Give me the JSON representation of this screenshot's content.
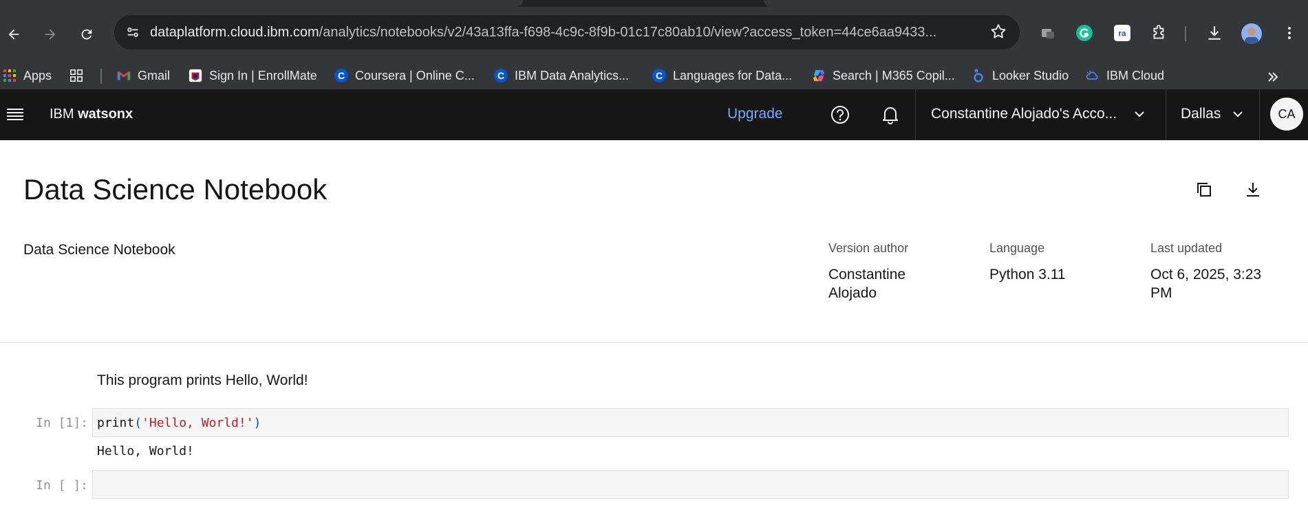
{
  "browser": {
    "url_host": "dataplatform.cloud.ibm.com",
    "url_path": "/analytics/notebooks/v2/43a13ffa-f698-4c9c-8f9b-01c17c80ab10/view?access_token=44ce6aa9433...",
    "bookmarks": [
      {
        "label": "Apps",
        "icon": "apps-grid-icon"
      },
      {
        "label": "",
        "icon": "tab-groups-icon"
      },
      {
        "label": "Gmail",
        "icon": "gmail-icon"
      },
      {
        "label": "Sign In | EnrollMate",
        "icon": "enrollmate-icon"
      },
      {
        "label": "Coursera | Online C...",
        "icon": "coursera-icon"
      },
      {
        "label": "IBM Data Analytics...",
        "icon": "coursera-icon"
      },
      {
        "label": "Languages for Data...",
        "icon": "coursera-icon"
      },
      {
        "label": "Search | M365 Copil...",
        "icon": "copilot-icon"
      },
      {
        "label": "Looker Studio",
        "icon": "looker-icon"
      },
      {
        "label": "IBM Cloud",
        "icon": "ibm-cloud-icon"
      }
    ]
  },
  "header": {
    "brand_prefix": "IBM ",
    "brand_name": "watsonx",
    "upgrade_label": "Upgrade",
    "account_label": "Constantine Alojado's Acco...",
    "region_label": "Dallas",
    "avatar_initials": "CA"
  },
  "notebook": {
    "title": "Data Science Notebook",
    "description": "Data Science Notebook",
    "meta": {
      "version_author_label": "Version author",
      "version_author_line1": "Constantine",
      "version_author_line2": "Alojado",
      "language_label": "Language",
      "language_value": "Python 3.11",
      "last_updated_label": "Last updated",
      "last_updated_line1": "Oct 6, 2025, 3:23",
      "last_updated_line2": "PM"
    },
    "markdown_text": "This program prints Hello, World!",
    "cells": [
      {
        "prompt": "In [1]:",
        "code_fn": "print",
        "code_open": "(",
        "code_str": "'Hello, World!'",
        "code_close": ")",
        "output": "Hello, World!"
      },
      {
        "prompt": "In [ ]:"
      }
    ]
  }
}
